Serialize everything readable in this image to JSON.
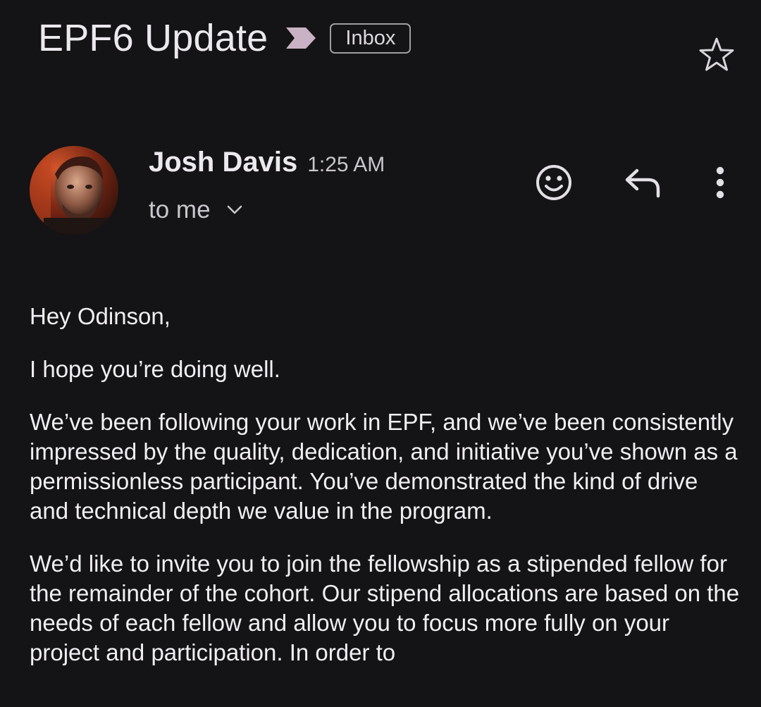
{
  "email": {
    "subject": "EPF6 Update",
    "label": "Inbox",
    "sender": "Josh Davis",
    "time": "1:25 AM",
    "recipient": "to me"
  },
  "icons": {
    "importance": "importance-marker-icon",
    "star": "star-outline-icon",
    "emoji": "emoji-reaction-icon",
    "reply": "reply-icon",
    "more": "more-vertical-icon",
    "recipient_expand": "chevron-down-icon"
  },
  "colors": {
    "background": "#141315",
    "importance_marker": "#c9b2c3",
    "text": "#f1eff3",
    "muted_text": "#c9c6cc"
  },
  "body": {
    "greeting": "Hey Odinson,",
    "p1": "I hope you’re doing well.",
    "p2": "We’ve been following your work in EPF, and we’ve been consistently impressed by the quality, dedication, and initiative you’ve shown as a permissionless participant. You’ve demonstrated the kind of drive and technical depth we value in the program.",
    "p3": "We’d like to invite you to join the fellowship as a stipended fellow for the remainder of the cohort. Our stipend allocations are based on the needs of each fellow and allow you to focus more fully on your project and participation. In order to"
  }
}
